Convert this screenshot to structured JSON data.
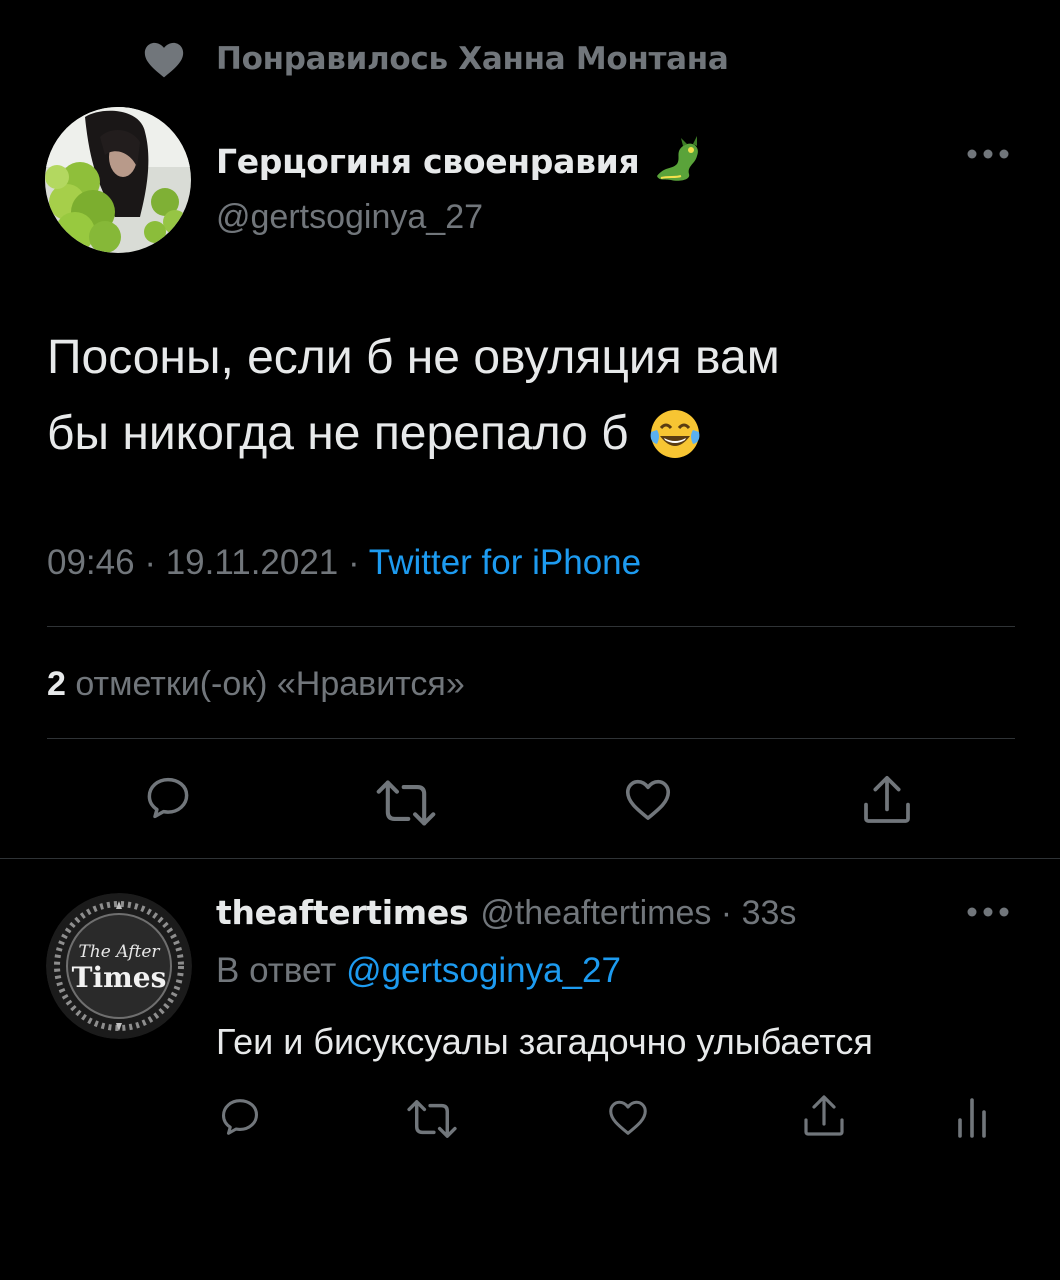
{
  "social_context": {
    "icon": "heart-filled-icon",
    "text": "Понравилось Ханна Монтана"
  },
  "tweet": {
    "author_name": "Герцогиня своенравия",
    "author_badge": "dragon-emoji",
    "handle": "@gertsoginya_27",
    "text_line1": "Посоны, если б не овуляция вам",
    "text_line2": "бы никогда не перепало б",
    "text_emoji": "face-with-tears-of-joy-emoji",
    "time": "09:46",
    "date": "19.11.2021",
    "separator": " · ",
    "source": "Twitter for iPhone",
    "likes_count": "2",
    "likes_label": " отметки(-ок) «Нравится»"
  },
  "actions": [
    "reply-icon",
    "retweet-icon",
    "like-icon",
    "share-icon"
  ],
  "reply": {
    "author_name": "theaftertimes",
    "handle": "@theaftertimes",
    "time": "33s",
    "separator": " · ",
    "reply_prefix": "В ответ ",
    "reply_mention": "@gertsoginya_27",
    "text": "Геи и бисуксуалы загадочно улыбается",
    "actions": [
      "reply-icon",
      "retweet-icon",
      "like-icon",
      "share-icon",
      "analytics-icon"
    ]
  },
  "colors": {
    "background": "#000000",
    "text_primary": "#e7e9ea",
    "text_secondary": "#71767b",
    "accent": "#1d9bf0",
    "divider": "#2f3336"
  }
}
